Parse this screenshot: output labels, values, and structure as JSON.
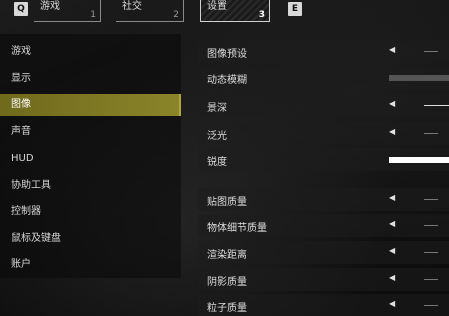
{
  "tabs": [
    {
      "key": "Q",
      "label": "游戏",
      "num": "1",
      "active": false
    },
    {
      "label": "社交",
      "num": "2",
      "active": false
    },
    {
      "label": "设置",
      "num": "3",
      "active": true,
      "key": "E"
    }
  ],
  "sidebar": {
    "items": [
      {
        "label": "游戏"
      },
      {
        "label": "显示"
      },
      {
        "label": "图像",
        "selected": true
      },
      {
        "label": "声音"
      },
      {
        "label": "HUD"
      },
      {
        "label": "协助工具"
      },
      {
        "label": "控制器"
      },
      {
        "label": "鼠标及键盘"
      },
      {
        "label": "账户"
      }
    ]
  },
  "settings": {
    "group1": [
      {
        "label": "图像预设",
        "control": "selector"
      },
      {
        "label": "动态模糊",
        "control": "slider",
        "level": 0.0
      },
      {
        "label": "景深",
        "control": "selector"
      },
      {
        "label": "泛光",
        "control": "selector"
      },
      {
        "label": "锐度",
        "control": "slider",
        "level": 1.0
      }
    ],
    "group2": [
      {
        "label": "贴图质量",
        "control": "selector"
      },
      {
        "label": "物体细节质量",
        "control": "selector"
      },
      {
        "label": "渲染距离",
        "control": "selector"
      },
      {
        "label": "阴影质量",
        "control": "selector"
      },
      {
        "label": "粒子质量",
        "control": "selector"
      }
    ]
  },
  "colors": {
    "accent": "#8a842a",
    "slider_fill": "#ffffff"
  },
  "icons": {
    "arrow": "◀"
  }
}
